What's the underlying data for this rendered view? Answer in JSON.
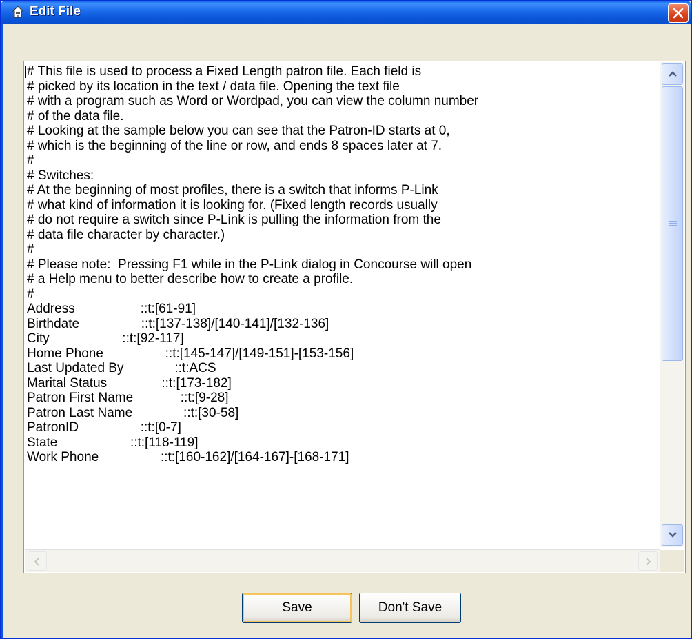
{
  "window": {
    "title": "Edit File"
  },
  "editor": {
    "lines": [
      "# This file is used to process a Fixed Length patron file. Each field is",
      "# picked by its location in the text / data file. Opening the text file",
      "# with a program such as Word or Wordpad, you can view the column number",
      "# of the data file.",
      "# Looking at the sample below you can see that the Patron-ID starts at 0,",
      "# which is the beginning of the line or row, and ends 8 spaces later at 7.",
      "#",
      "# Switches:",
      "# At the beginning of most profiles, there is a switch that informs P-Link",
      "# what kind of information it is looking for. (Fixed length records usually",
      "# do not require a switch since P-Link is pulling the information from the",
      "# data file character by character.)",
      "#",
      "# Please note:  Pressing F1 while in the P-Link dialog in Concourse will open",
      "# a Help menu to better describe how to create a profile.",
      "#",
      "Address                  ::t:[61-91]",
      "Birthdate                 ::t:[137-138]/[140-141]/[132-136]",
      "City                    ::t:[92-117]",
      "Home Phone                 ::t:[145-147]/[149-151]-[153-156]",
      "Last Updated By              ::t:ACS",
      "Marital Status               ::t:[173-182]",
      "Patron First Name             ::t:[9-28]",
      "Patron Last Name              ::t:[30-58]",
      "PatronID                 ::t:[0-7]",
      "State                    ::t:[118-119]",
      "Work Phone                 ::t:[160-162]/[164-167]-[168-171]"
    ]
  },
  "buttons": {
    "save": "Save",
    "dont_save": "Don't Save"
  },
  "icons": {
    "title": "app-icon",
    "close": "close-icon",
    "scroll_up": "scroll-up-arrow-icon",
    "scroll_down": "scroll-down-arrow-icon",
    "scroll_left": "scroll-left-arrow-icon",
    "scroll_right": "scroll-right-arrow-icon"
  },
  "colors": {
    "titlebar": "#0b55d8",
    "close": "#d9421d",
    "dialog_bg": "#ece9d8"
  }
}
